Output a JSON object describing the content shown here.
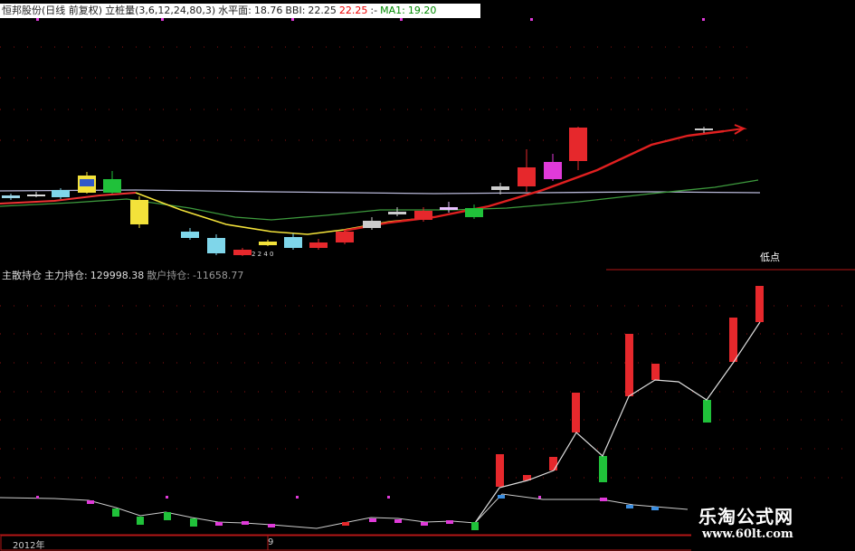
{
  "header": {
    "stock": "恒邦股份(日线 前复权)",
    "indicator": "立桩量(3,6,12,24,80,3)",
    "level_label": "水平面:",
    "level_value": "18.76",
    "bbi_label": "BBI:",
    "bbi_value": "22.25",
    "val2": "22.25",
    "sep": ":-",
    "ma1_label": "MA1:",
    "ma1_value": "19.20"
  },
  "sub_header": {
    "name": "主散持仓",
    "main_label": "主力持仓:",
    "main_value": "129998.38",
    "retail_label": "散户持仓:",
    "retail_value": "-11658.77"
  },
  "labels": {
    "low_point": "低点",
    "year": "2012年",
    "month": "9",
    "small_note": "2 2 4 0"
  },
  "watermark": {
    "title": "乐淘公式网",
    "url": "www.60lt.com"
  },
  "colors": {
    "up": "#e6282c",
    "down": "#20c13a",
    "cyan": "#7fd6ea",
    "yellow": "#f3e23a",
    "magenta": "#e03ad9",
    "grid": "#8a1212"
  }
}
